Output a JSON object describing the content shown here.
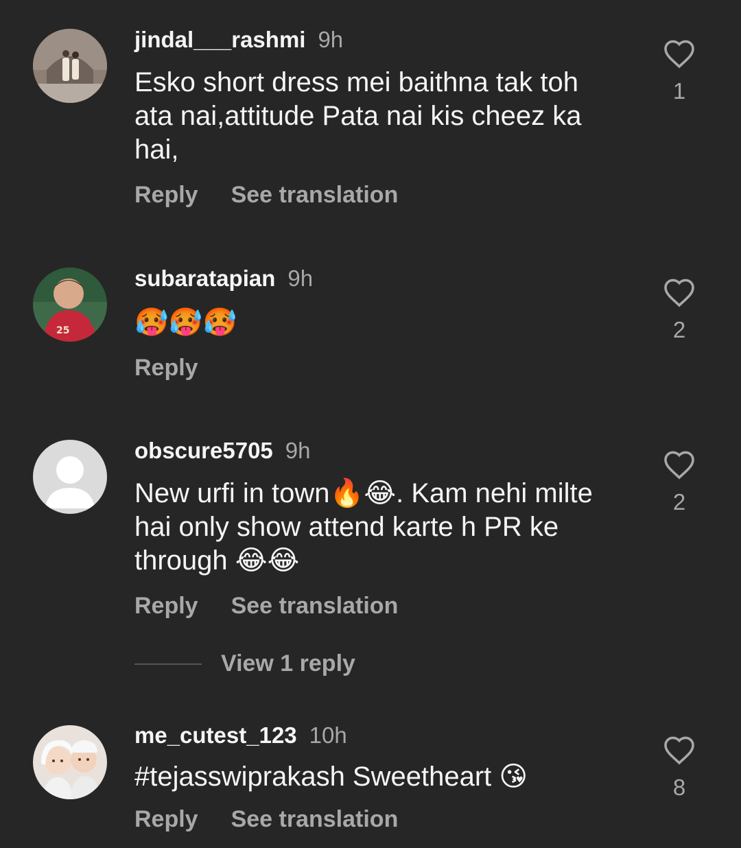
{
  "comments": [
    {
      "username": "jindal___rashmi",
      "time": "9h",
      "text": "Esko short dress mei baithna tak toh\nata nai,attitude Pata nai kis cheez ka\nhai,",
      "reply_label": "Reply",
      "translate_label": "See translation",
      "likes": "1"
    },
    {
      "username": "subaratapian",
      "time": "9h",
      "text": "🥵🥵🥵",
      "reply_label": "Reply",
      "likes": "2"
    },
    {
      "username": "obscure5705",
      "time": "9h",
      "text": "New urfi in town🔥😂. Kam nehi milte\nhai only show attend karte h PR ke\nthrough 😂😂",
      "reply_label": "Reply",
      "translate_label": "See translation",
      "likes": "2",
      "view_replies_label": "View 1 reply"
    },
    {
      "username": "me_cutest_123",
      "time": "10h",
      "text": "#tejasswiprakash Sweetheart 😘",
      "reply_label": "Reply",
      "translate_label": "See translation",
      "likes": "8"
    }
  ],
  "icons": {
    "like": "heart-outline-icon",
    "default_avatar": "default-avatar-icon"
  },
  "colors": {
    "background": "#262626",
    "primary_text": "#f5f5f5",
    "secondary_text": "#a8a8a8"
  }
}
